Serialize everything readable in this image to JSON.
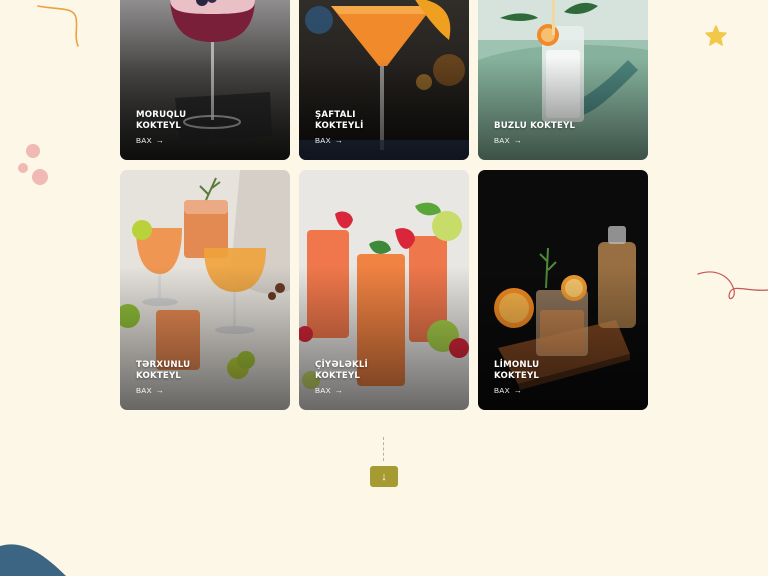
{
  "colors": {
    "background": "#fdf7e7",
    "accent_button": "#a69a32",
    "doodle_orange": "#e9a23f",
    "doodle_pink": "#f1b9b3",
    "doodle_red": "#c55555",
    "star_yellow": "#f1c84a",
    "corner_blue": "#3c6584"
  },
  "cards": [
    {
      "title": "MORUQLU KOKTEYL",
      "link": "BAX",
      "arrow": "→",
      "image": "berry-cocktail-photo"
    },
    {
      "title": "ŞAFTALI KOKTEYLİ",
      "link": "BAX",
      "arrow": "→",
      "image": "peach-cocktail-photo"
    },
    {
      "title": "BUZLU KOKTEYL",
      "link": "BAX",
      "arrow": "→",
      "image": "iced-cocktail-photo"
    },
    {
      "title": "TƏRXUNLU KOKTEYL",
      "link": "BAX",
      "arrow": "→",
      "image": "tarragon-cocktail-photo"
    },
    {
      "title": "ÇİYƏLƏKLİ KOKTEYL",
      "link": "BAX",
      "arrow": "→",
      "image": "strawberry-cocktail-photo"
    },
    {
      "title": "LİMONLU KOKTEYL",
      "link": "BAX",
      "arrow": "→",
      "image": "lemon-cocktail-photo"
    }
  ],
  "scroll_button": {
    "icon": "arrow-down-icon",
    "glyph": "↓"
  }
}
